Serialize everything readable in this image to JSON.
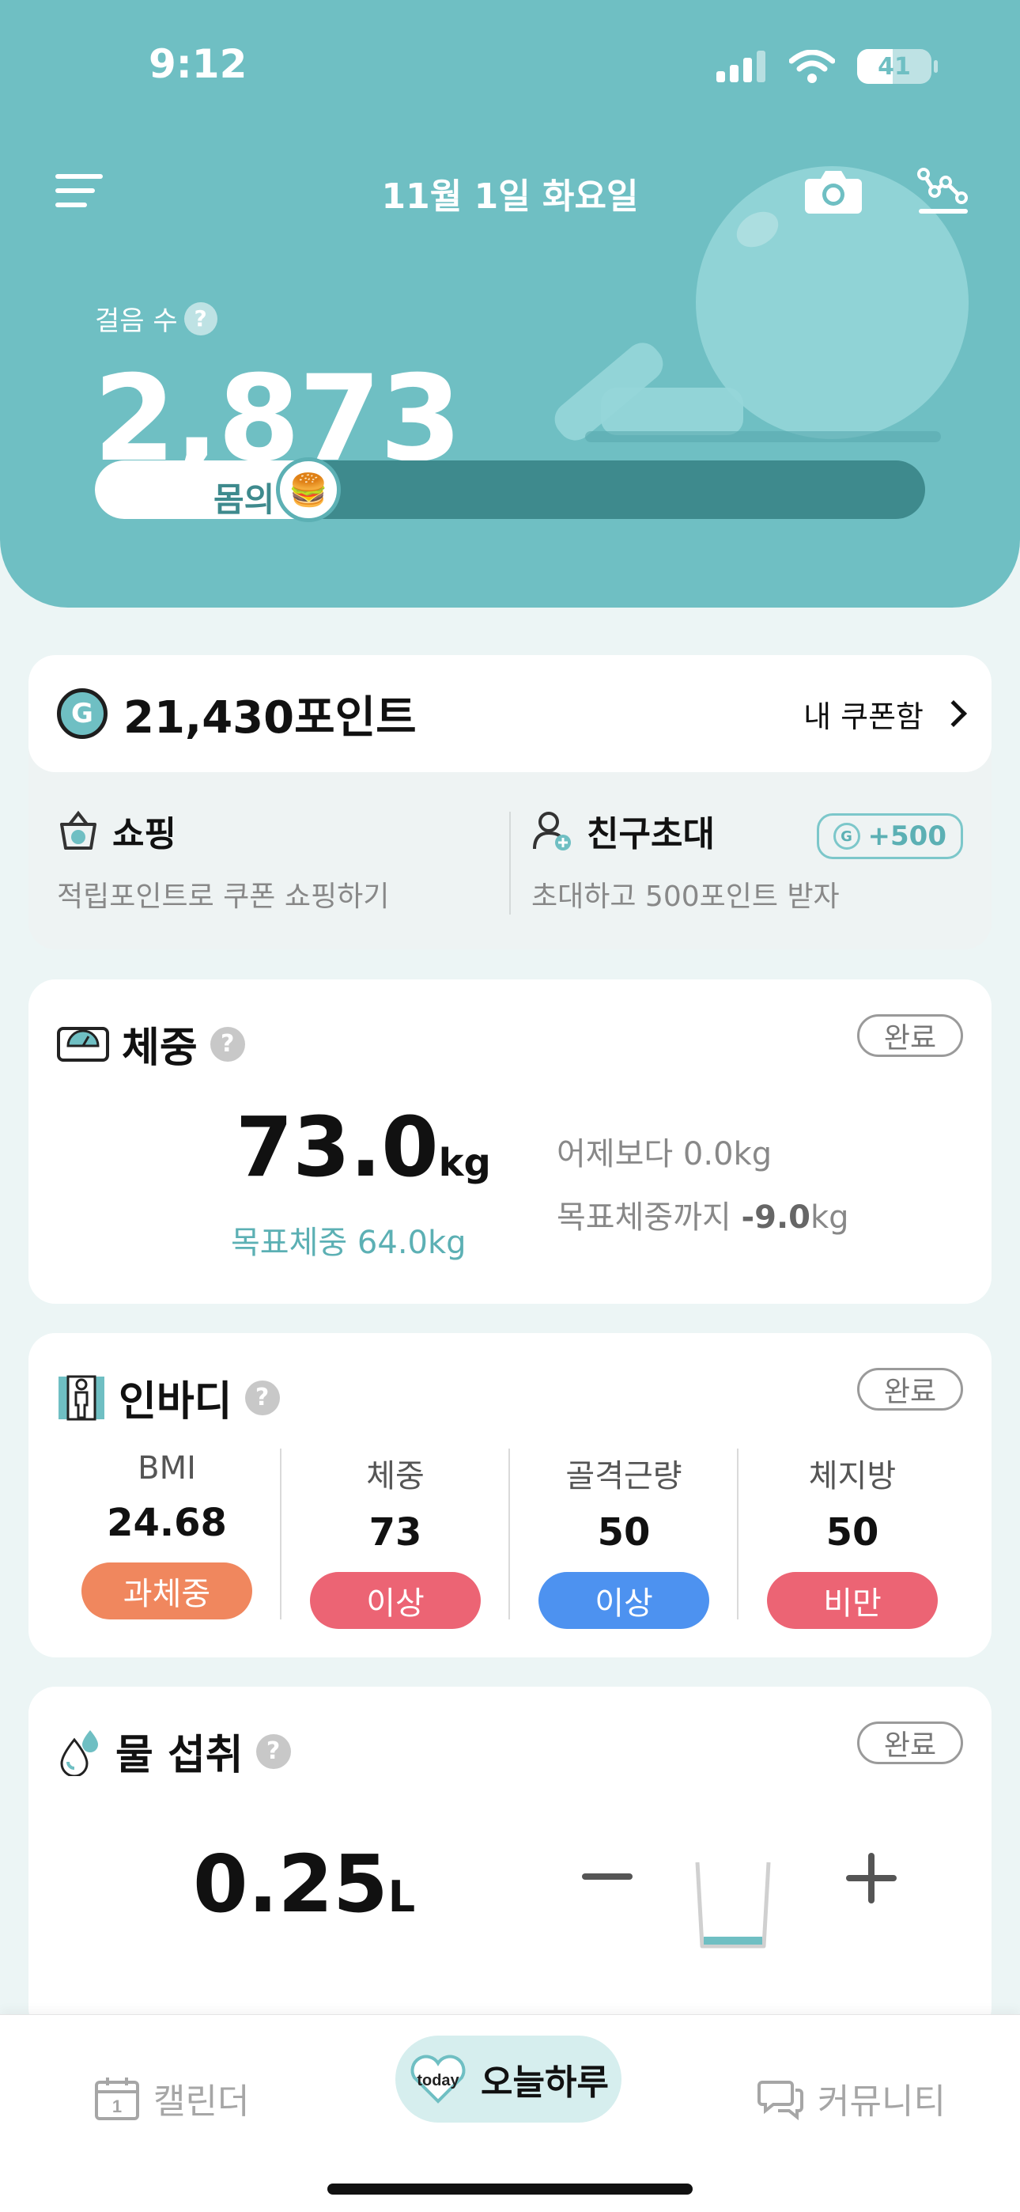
{
  "status_bar": {
    "time": "9:12",
    "battery": "41"
  },
  "header": {
    "date": "11월 1일 화요일",
    "steps_label": "걸음 수",
    "steps_value": "2,873",
    "progress_text": "몸의",
    "progress_fraction": 0.29,
    "progress_icon": "burger-emoji",
    "progress_emoji": "🍔",
    "help": "?"
  },
  "points": {
    "badge": "G",
    "value": "21,430포인트",
    "coupon_label": "내 쿠폰함",
    "shopping_title": "쇼핑",
    "shopping_sub": "적립포인트로 쿠폰 쇼핑하기",
    "invite_title": "친구초대",
    "invite_sub": "초대하고 500포인트 받자",
    "invite_bonus": "+500",
    "bonus_badge": "G"
  },
  "weight": {
    "title": "체중",
    "done": "완료",
    "value": "73.0",
    "unit": "kg",
    "goal": "목표체중 64.0kg",
    "diff": "어제보다 0.0kg",
    "remaining_label": "목표체중까지 ",
    "remaining_value": "-9.0",
    "remaining_unit": "kg"
  },
  "inbody": {
    "title": "인바디",
    "done": "완료",
    "items": [
      {
        "label": "BMI",
        "value": "24.68",
        "status": "과체중",
        "color": "#F0875E"
      },
      {
        "label": "체중",
        "value": "73",
        "status": "이상",
        "color": "#EC6474"
      },
      {
        "label": "골격근량",
        "value": "50",
        "status": "이상",
        "color": "#4D92F0"
      },
      {
        "label": "체지방",
        "value": "50",
        "status": "비만",
        "color": "#EC6474"
      }
    ]
  },
  "water": {
    "title": "물 섭취",
    "done": "완료",
    "value": "0.25",
    "unit": "L",
    "fill_fraction": 0.1
  },
  "tabs": {
    "calendar": "캘린더",
    "calendar_day": "1",
    "today_badge": "today",
    "today": "오늘하루",
    "community": "커뮤니티"
  },
  "colors": {
    "accent": "#6FBFC3",
    "accent_dark": "#3E8A8D",
    "background": "#ECF5F5"
  }
}
